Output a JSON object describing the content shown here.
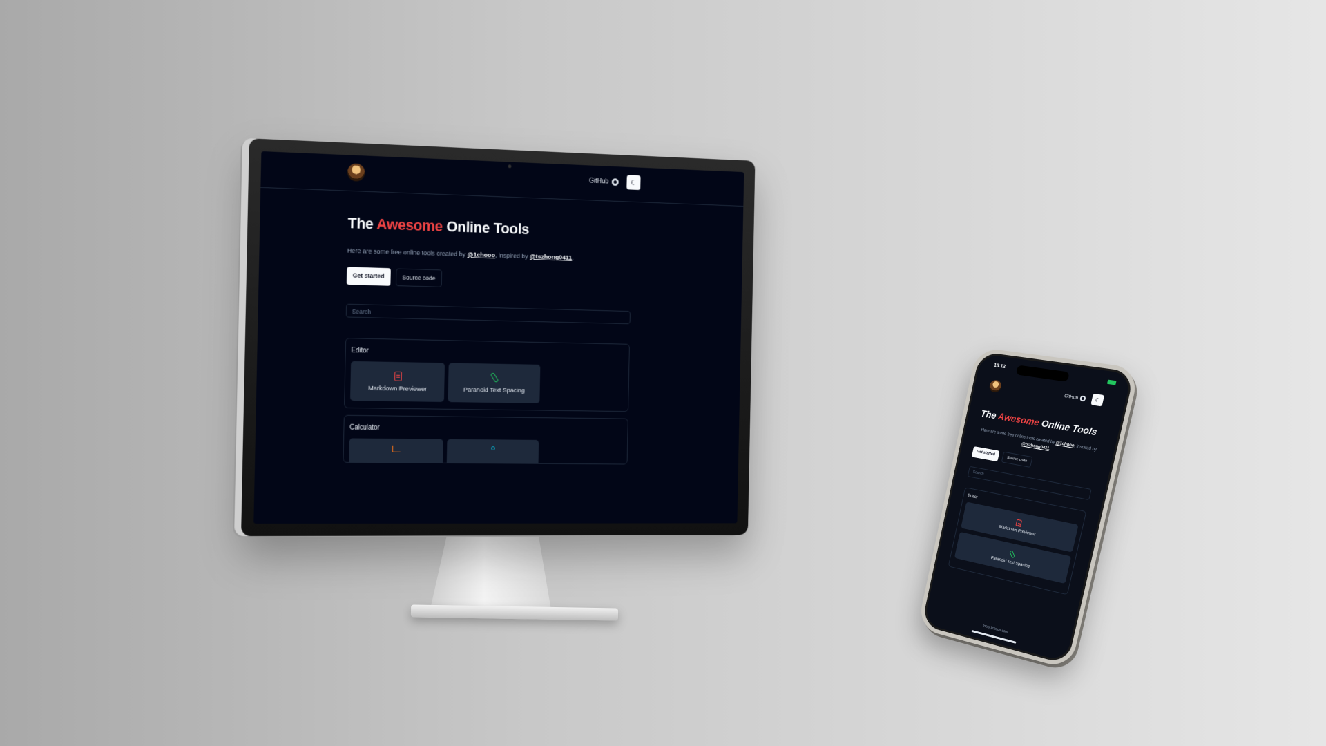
{
  "site": {
    "github_label": "GitHub",
    "theme_icon": "moon-icon",
    "title_prefix": "The ",
    "title_accent": "Awesome",
    "title_suffix": " Online Tools",
    "subtitle_prefix": "Here are some free online tools created by ",
    "author": "@1chooo",
    "subtitle_mid": ", inspired by ",
    "inspiration": "@tszhong0411",
    "subtitle_end": ".",
    "get_started": "Get started",
    "source_code": "Source code",
    "search_placeholder": "Search",
    "accent_color": "#ef4444"
  },
  "sections": [
    {
      "title": "Editor",
      "cards": [
        {
          "label": "Markdown Previewer",
          "icon": "document-icon",
          "color": "#ef4444"
        },
        {
          "label": "Paranoid Text Spacing",
          "icon": "paperclip-icon",
          "color": "#22c55e"
        }
      ]
    },
    {
      "title": "Calculator",
      "cards": [
        {
          "label": "",
          "icon": "chart-icon",
          "color": "#f97316"
        },
        {
          "label": "",
          "icon": "ruler-icon",
          "color": "#06b6d4"
        }
      ]
    }
  ],
  "phone": {
    "time": "18:12",
    "url": "tools.1chooo.com"
  }
}
